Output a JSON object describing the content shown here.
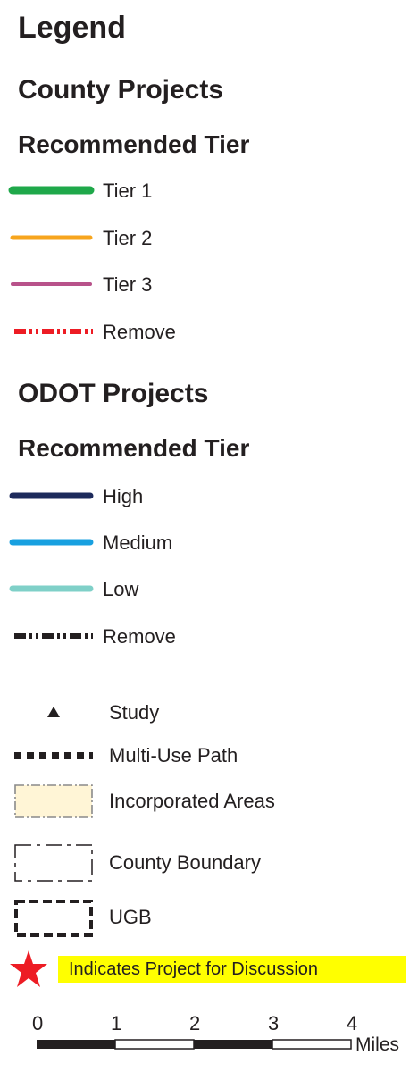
{
  "legend": {
    "title": "Legend",
    "county": {
      "heading": "County Projects",
      "subheading": "Recommended Tier",
      "items": [
        {
          "label": "Tier 1",
          "color": "#1fa84a",
          "style": "thick-solid"
        },
        {
          "label": "Tier 2",
          "color": "#f7a51d",
          "style": "solid"
        },
        {
          "label": "Tier 3",
          "color": "#b8528a",
          "style": "solid"
        },
        {
          "label": "Remove",
          "color": "#ed1c24",
          "style": "dash-dot"
        }
      ]
    },
    "odot": {
      "heading": "ODOT Projects",
      "subheading": "Recommended Tier",
      "items": [
        {
          "label": "High",
          "color": "#1d2a5b",
          "style": "thick-solid"
        },
        {
          "label": "Medium",
          "color": "#18a0e0",
          "style": "thick-solid"
        },
        {
          "label": "Low",
          "color": "#7fd0c8",
          "style": "thick-solid"
        },
        {
          "label": "Remove",
          "color": "#231f20",
          "style": "dash-dot"
        }
      ]
    },
    "features": [
      {
        "label": "Study",
        "icon": "triangle-icon"
      },
      {
        "label": "Multi-Use Path",
        "icon": "dotted-line-icon"
      },
      {
        "label": "Incorporated Areas",
        "icon": "area-fill-icon",
        "fill": "#fff5d6"
      },
      {
        "label": "County Boundary",
        "icon": "boundary-icon"
      },
      {
        "label": "UGB",
        "icon": "ugb-icon"
      }
    ],
    "discussion": {
      "label": "Indicates Project for Discussion",
      "star_color": "#ed1c24",
      "banner_color": "#ffff00"
    },
    "scale": {
      "ticks": [
        "0",
        "1",
        "2",
        "3",
        "4"
      ],
      "unit": "Miles"
    }
  }
}
